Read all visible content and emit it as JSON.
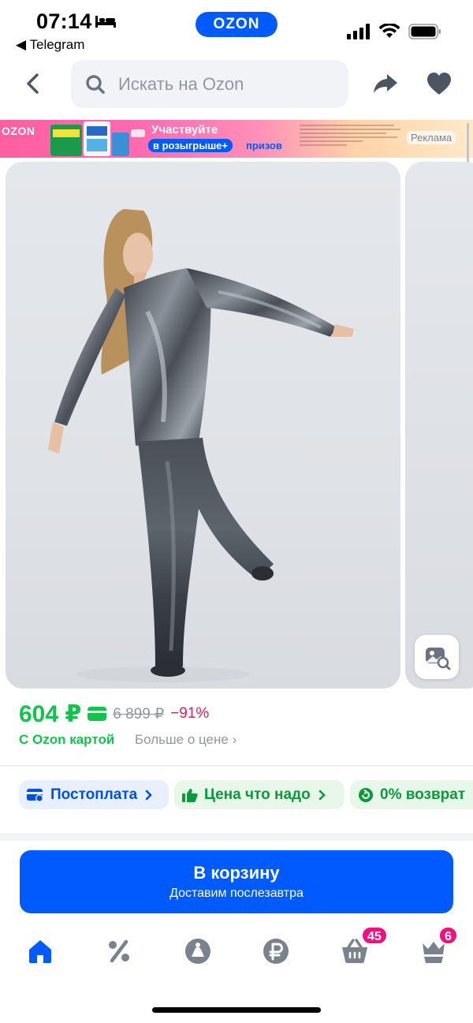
{
  "status_bar": {
    "time": "07:14",
    "back_app": "◀ Telegram",
    "logo": "OZON"
  },
  "header": {
    "search_placeholder": "Искать на Ozon"
  },
  "ad_banner": {
    "logo": "OZON",
    "cta_line1": "Участвуйте",
    "cta_highlight": "в розыгрыше+",
    "cta_tail": "призов",
    "label": "Реклама"
  },
  "product": {
    "price": "604 ₽",
    "old_price": "6 899 ₽",
    "discount": "−91%",
    "card_note": "С Ozon картой",
    "more_price": "Больше о цене ›"
  },
  "chips": [
    {
      "label": "Постоплата",
      "icon": "postpay-icon"
    },
    {
      "label": "Цена что надо",
      "icon": "thumb-up-icon"
    },
    {
      "label": "0% возврат",
      "icon": "return-icon"
    }
  ],
  "cart": {
    "title": "В корзину",
    "subtitle": "Доставим послезавтра"
  },
  "tabbar": {
    "cart_badge": "45",
    "account_badge": "6"
  },
  "colors": {
    "brand_blue": "#005bff",
    "price_green": "#10c44c",
    "discount_pink": "#f91155",
    "badge_magenta": "#f1117e"
  }
}
